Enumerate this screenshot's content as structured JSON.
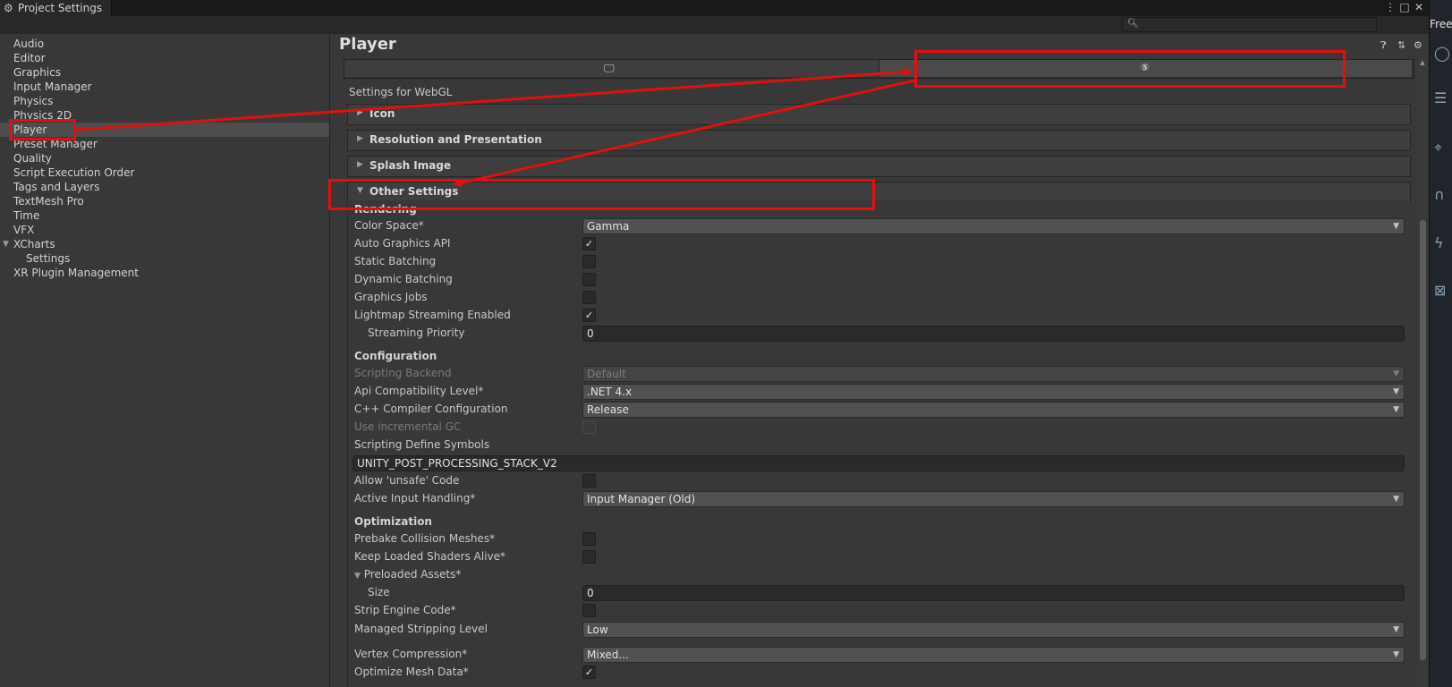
{
  "window": {
    "title": "Project Settings",
    "menu_icon": "more-vert-icon",
    "maximize_icon": "maximize-icon",
    "close_icon": "close-icon"
  },
  "search": {
    "placeholder": ""
  },
  "sidebar": {
    "items": [
      {
        "label": "Audio"
      },
      {
        "label": "Editor"
      },
      {
        "label": "Graphics"
      },
      {
        "label": "Input Manager"
      },
      {
        "label": "Physics"
      },
      {
        "label": "Physics 2D"
      },
      {
        "label": "Player"
      },
      {
        "label": "Preset Manager"
      },
      {
        "label": "Quality"
      },
      {
        "label": "Script Execution Order"
      },
      {
        "label": "Tags and Layers"
      },
      {
        "label": "TextMesh Pro"
      },
      {
        "label": "Time"
      },
      {
        "label": "VFX"
      },
      {
        "label": "XCharts"
      },
      {
        "label": "Settings"
      },
      {
        "label": "XR Plugin Management"
      }
    ],
    "selected": "Player"
  },
  "main": {
    "title": "Player",
    "settings_for": "Settings for WebGL",
    "tabs": [
      {
        "icon": "desktop-icon"
      },
      {
        "icon": "html5-icon"
      }
    ],
    "foldouts": {
      "icon": "Icon",
      "resolution": "Resolution and Presentation",
      "splash": "Splash Image",
      "other": "Other Settings"
    },
    "rendering": {
      "section": "Rendering",
      "color_space_label": "Color Space*",
      "color_space_value": "Gamma",
      "auto_graphics_api_label": "Auto Graphics API",
      "static_batching_label": "Static Batching",
      "dynamic_batching_label": "Dynamic Batching",
      "graphics_jobs_label": "Graphics Jobs",
      "lightmap_streaming_label": "Lightmap Streaming Enabled",
      "streaming_priority_label": "Streaming Priority",
      "streaming_priority_value": "0"
    },
    "configuration": {
      "section": "Configuration",
      "scripting_backend_label": "Scripting Backend",
      "scripting_backend_value": "Default",
      "api_compat_label": "Api Compatibility Level*",
      "api_compat_value": ".NET 4.x",
      "cpp_config_label": "C++ Compiler Configuration",
      "cpp_config_value": "Release",
      "incremental_gc_label": "Use incremental GC",
      "define_symbols_label": "Scripting Define Symbols",
      "define_symbols_value": "UNITY_POST_PROCESSING_STACK_V2",
      "unsafe_code_label": "Allow 'unsafe' Code",
      "input_handling_label": "Active Input Handling*",
      "input_handling_value": "Input Manager (Old)"
    },
    "optimization": {
      "section": "Optimization",
      "prebake_label": "Prebake Collision Meshes*",
      "keep_shaders_label": "Keep Loaded Shaders Alive*",
      "preloaded_assets_label": "Preloaded Assets*",
      "size_label": "Size",
      "size_value": "0",
      "strip_engine_label": "Strip Engine Code*",
      "managed_stripping_label": "Managed Stripping Level",
      "managed_stripping_value": "Low",
      "vertex_compression_label": "Vertex Compression*",
      "vertex_compression_value": "Mixed...",
      "optimize_mesh_label": "Optimize Mesh Data*"
    },
    "checked": {
      "auto_graphics_api": true,
      "static_batching": false,
      "dynamic_batching": false,
      "graphics_jobs": false,
      "lightmap_streaming": true,
      "incremental_gc": false,
      "unsafe_code": false,
      "prebake": false,
      "keep_shaders": false,
      "strip_engine": false,
      "optimize_mesh": true
    }
  },
  "side_strip": {
    "text": "Free"
  },
  "colors": {
    "annotation": "#e01010",
    "background": "#383838",
    "selected": "#4d4d4d"
  }
}
